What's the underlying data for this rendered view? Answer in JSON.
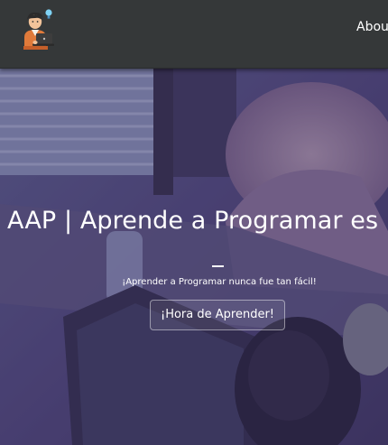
{
  "navbar": {
    "logo_icon": "programmer-avatar-icon",
    "links": [
      {
        "label": "About"
      }
    ]
  },
  "hero": {
    "title": "AAP | Aprende a Programar es un hecho",
    "divider": "_",
    "subtitle": "¡Aprender a Programar nunca fue tan fácil!",
    "button_label": "¡Hora de Aprender!",
    "background_icon": "person-coding-at-laptop-photo"
  },
  "colors": {
    "navbar_bg": "#353839",
    "hero_tint": "#3f3470",
    "text": "#ffffff"
  }
}
